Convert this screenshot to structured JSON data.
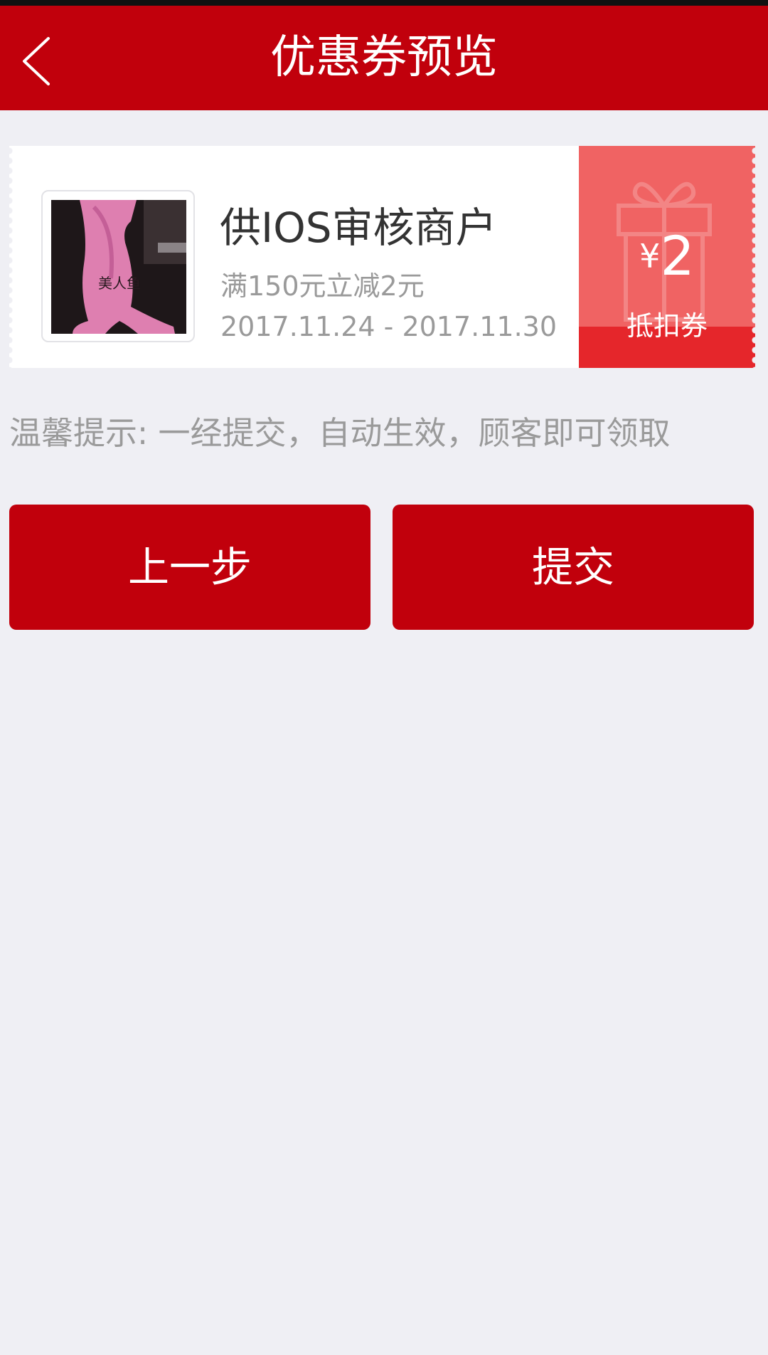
{
  "nav": {
    "title": "优惠券预览",
    "back_icon": "chevron-left-icon"
  },
  "coupon": {
    "merchant_name": "供IOS审核商户",
    "rule": "满150元立减2元",
    "date_range": "2017.11.24 - 2017.11.30",
    "currency_symbol": "¥",
    "amount": "2",
    "type_label": "抵扣券",
    "badge_icon": "gift-icon"
  },
  "tip": "温馨提示: 一经提交，自动生效，顾客即可领取",
  "buttons": {
    "prev_label": "上一步",
    "submit_label": "提交"
  },
  "colors": {
    "brand_red": "#c1000c",
    "badge_red": "#f06363",
    "badge_dark_red": "#e5262b",
    "background": "#efeff4",
    "muted_text": "#9a9a9a"
  }
}
